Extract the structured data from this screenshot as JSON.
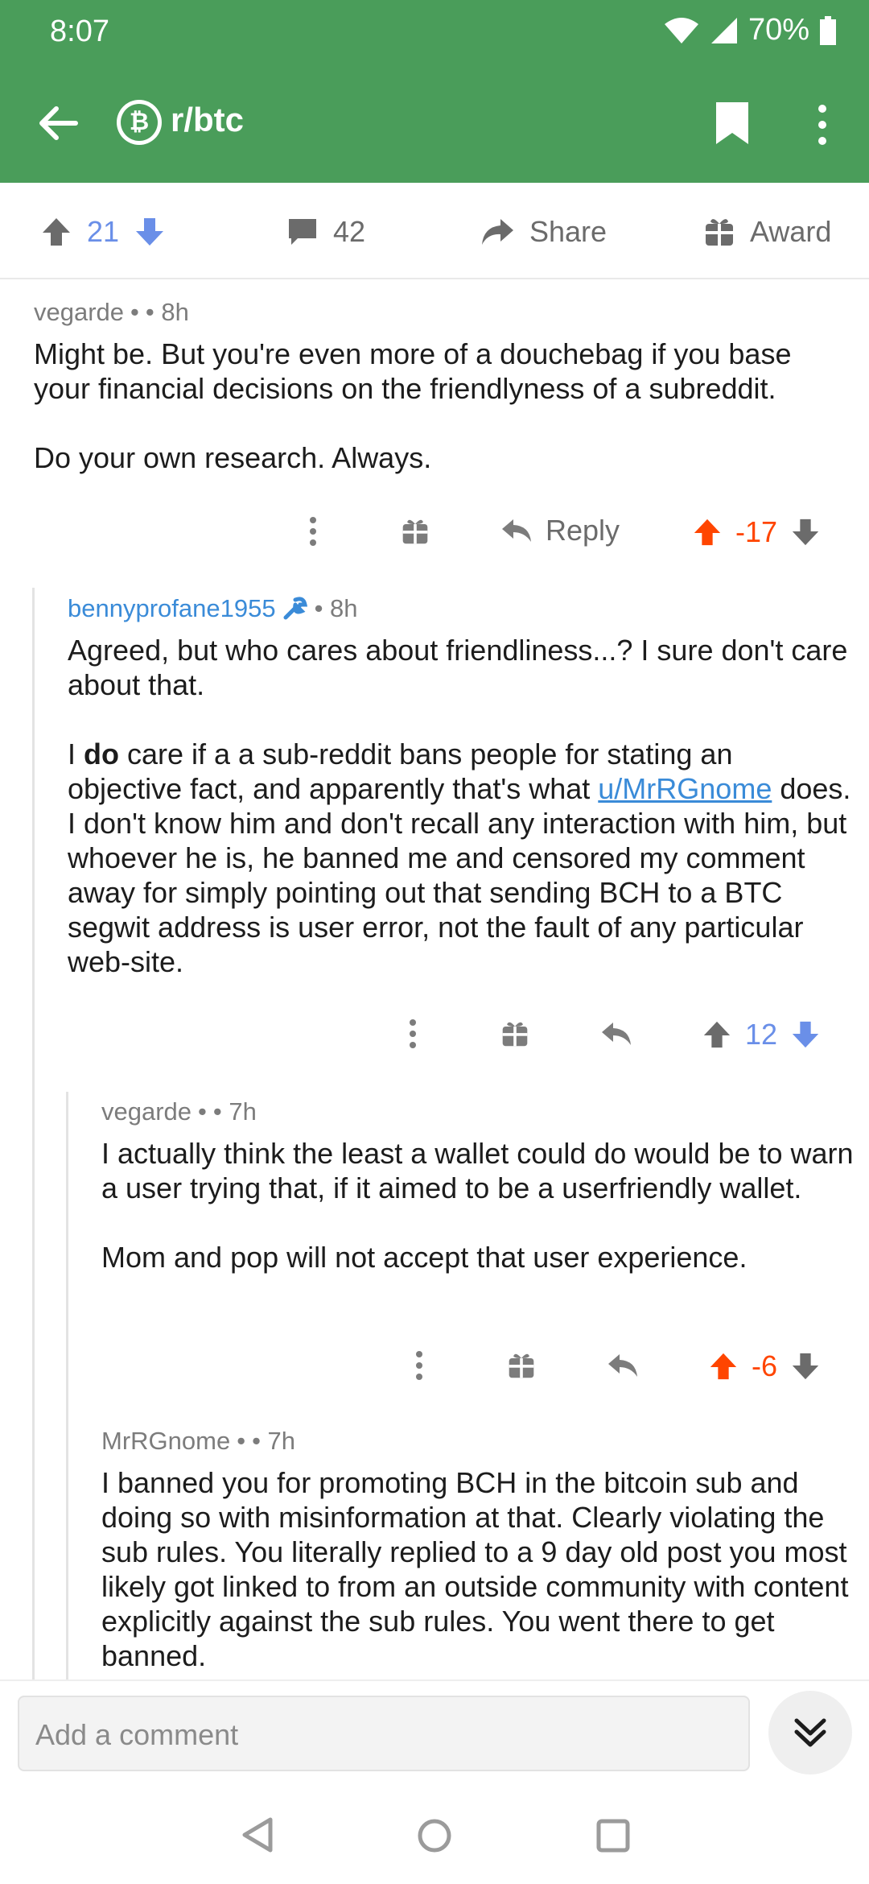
{
  "status": {
    "time": "8:07",
    "battery": "70%"
  },
  "toolbar": {
    "subreddit": "r/btc",
    "sub_icon_glyph": "₿"
  },
  "post_actions": {
    "score": "21",
    "comments": "42",
    "share": "Share",
    "award": "Award"
  },
  "comments": [
    {
      "author": "vegarde",
      "sep1": "•",
      "sep2": "• 8h",
      "paragraphs": [
        "Might be. But you're even more of a douchebag if you base your financial decisions on the friendlyness of a subreddit.",
        "Do your own research. Always."
      ],
      "reply": "Reply",
      "score": "-17"
    },
    {
      "author": "bennyprofane1955",
      "sep2": "• 8h",
      "p1": "Agreed, but who cares about friendliness...?  I sure don't care about that.",
      "p2_a": "I ",
      "p2_bold": "do",
      "p2_b": " care if a a sub-reddit bans people for stating an objective fact, and apparently that's what ",
      "p2_link": "u/MrRGnome",
      "p2_c": " does.  I don't know him and don't recall any interaction with him, but whoever he is, he banned me and censored my comment away for simply pointing out that sending BCH to a BTC segwit address is user error, not the fault of any particular web-site.",
      "score": "12"
    },
    {
      "author": "vegarde",
      "sep1": "•",
      "sep2": "• 7h",
      "paragraphs": [
        "I actually think the least a wallet could do would be to warn a user trying that, if it aimed to be a userfriendly wallet.",
        "Mom and pop will not accept that user experience."
      ],
      "score": "-6"
    },
    {
      "author": "MrRGnome",
      "sep1": "•",
      "sep2": "• 7h",
      "paragraphs": [
        "I banned you for promoting BCH in the bitcoin sub and doing so with misinformation at that. Clearly violating the sub rules. You literally replied to a 9 day old post you most likely got linked to from an outside community with content explicitly against the sub rules. You went there to get banned."
      ]
    }
  ],
  "composer": {
    "placeholder": "Add a comment"
  },
  "colors": {
    "header": "#4a9d5a",
    "upvote": "#ff4500",
    "downvote": "#6a8fe8",
    "link": "#3a8bd8"
  }
}
